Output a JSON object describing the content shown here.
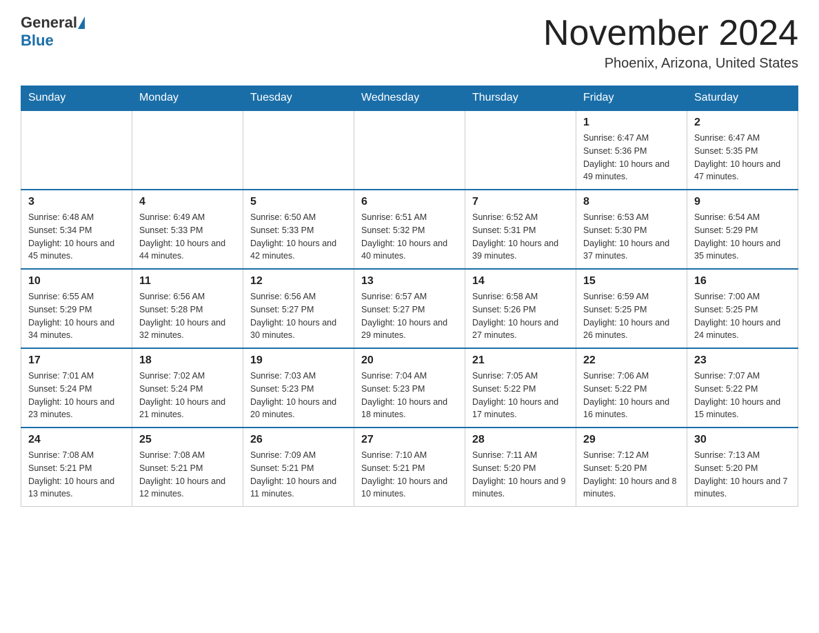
{
  "header": {
    "logo_general": "General",
    "logo_blue": "Blue",
    "month_title": "November 2024",
    "location": "Phoenix, Arizona, United States"
  },
  "days_of_week": [
    "Sunday",
    "Monday",
    "Tuesday",
    "Wednesday",
    "Thursday",
    "Friday",
    "Saturday"
  ],
  "weeks": [
    [
      {
        "day": "",
        "info": ""
      },
      {
        "day": "",
        "info": ""
      },
      {
        "day": "",
        "info": ""
      },
      {
        "day": "",
        "info": ""
      },
      {
        "day": "",
        "info": ""
      },
      {
        "day": "1",
        "info": "Sunrise: 6:47 AM\nSunset: 5:36 PM\nDaylight: 10 hours and 49 minutes."
      },
      {
        "day": "2",
        "info": "Sunrise: 6:47 AM\nSunset: 5:35 PM\nDaylight: 10 hours and 47 minutes."
      }
    ],
    [
      {
        "day": "3",
        "info": "Sunrise: 6:48 AM\nSunset: 5:34 PM\nDaylight: 10 hours and 45 minutes."
      },
      {
        "day": "4",
        "info": "Sunrise: 6:49 AM\nSunset: 5:33 PM\nDaylight: 10 hours and 44 minutes."
      },
      {
        "day": "5",
        "info": "Sunrise: 6:50 AM\nSunset: 5:33 PM\nDaylight: 10 hours and 42 minutes."
      },
      {
        "day": "6",
        "info": "Sunrise: 6:51 AM\nSunset: 5:32 PM\nDaylight: 10 hours and 40 minutes."
      },
      {
        "day": "7",
        "info": "Sunrise: 6:52 AM\nSunset: 5:31 PM\nDaylight: 10 hours and 39 minutes."
      },
      {
        "day": "8",
        "info": "Sunrise: 6:53 AM\nSunset: 5:30 PM\nDaylight: 10 hours and 37 minutes."
      },
      {
        "day": "9",
        "info": "Sunrise: 6:54 AM\nSunset: 5:29 PM\nDaylight: 10 hours and 35 minutes."
      }
    ],
    [
      {
        "day": "10",
        "info": "Sunrise: 6:55 AM\nSunset: 5:29 PM\nDaylight: 10 hours and 34 minutes."
      },
      {
        "day": "11",
        "info": "Sunrise: 6:56 AM\nSunset: 5:28 PM\nDaylight: 10 hours and 32 minutes."
      },
      {
        "day": "12",
        "info": "Sunrise: 6:56 AM\nSunset: 5:27 PM\nDaylight: 10 hours and 30 minutes."
      },
      {
        "day": "13",
        "info": "Sunrise: 6:57 AM\nSunset: 5:27 PM\nDaylight: 10 hours and 29 minutes."
      },
      {
        "day": "14",
        "info": "Sunrise: 6:58 AM\nSunset: 5:26 PM\nDaylight: 10 hours and 27 minutes."
      },
      {
        "day": "15",
        "info": "Sunrise: 6:59 AM\nSunset: 5:25 PM\nDaylight: 10 hours and 26 minutes."
      },
      {
        "day": "16",
        "info": "Sunrise: 7:00 AM\nSunset: 5:25 PM\nDaylight: 10 hours and 24 minutes."
      }
    ],
    [
      {
        "day": "17",
        "info": "Sunrise: 7:01 AM\nSunset: 5:24 PM\nDaylight: 10 hours and 23 minutes."
      },
      {
        "day": "18",
        "info": "Sunrise: 7:02 AM\nSunset: 5:24 PM\nDaylight: 10 hours and 21 minutes."
      },
      {
        "day": "19",
        "info": "Sunrise: 7:03 AM\nSunset: 5:23 PM\nDaylight: 10 hours and 20 minutes."
      },
      {
        "day": "20",
        "info": "Sunrise: 7:04 AM\nSunset: 5:23 PM\nDaylight: 10 hours and 18 minutes."
      },
      {
        "day": "21",
        "info": "Sunrise: 7:05 AM\nSunset: 5:22 PM\nDaylight: 10 hours and 17 minutes."
      },
      {
        "day": "22",
        "info": "Sunrise: 7:06 AM\nSunset: 5:22 PM\nDaylight: 10 hours and 16 minutes."
      },
      {
        "day": "23",
        "info": "Sunrise: 7:07 AM\nSunset: 5:22 PM\nDaylight: 10 hours and 15 minutes."
      }
    ],
    [
      {
        "day": "24",
        "info": "Sunrise: 7:08 AM\nSunset: 5:21 PM\nDaylight: 10 hours and 13 minutes."
      },
      {
        "day": "25",
        "info": "Sunrise: 7:08 AM\nSunset: 5:21 PM\nDaylight: 10 hours and 12 minutes."
      },
      {
        "day": "26",
        "info": "Sunrise: 7:09 AM\nSunset: 5:21 PM\nDaylight: 10 hours and 11 minutes."
      },
      {
        "day": "27",
        "info": "Sunrise: 7:10 AM\nSunset: 5:21 PM\nDaylight: 10 hours and 10 minutes."
      },
      {
        "day": "28",
        "info": "Sunrise: 7:11 AM\nSunset: 5:20 PM\nDaylight: 10 hours and 9 minutes."
      },
      {
        "day": "29",
        "info": "Sunrise: 7:12 AM\nSunset: 5:20 PM\nDaylight: 10 hours and 8 minutes."
      },
      {
        "day": "30",
        "info": "Sunrise: 7:13 AM\nSunset: 5:20 PM\nDaylight: 10 hours and 7 minutes."
      }
    ]
  ]
}
